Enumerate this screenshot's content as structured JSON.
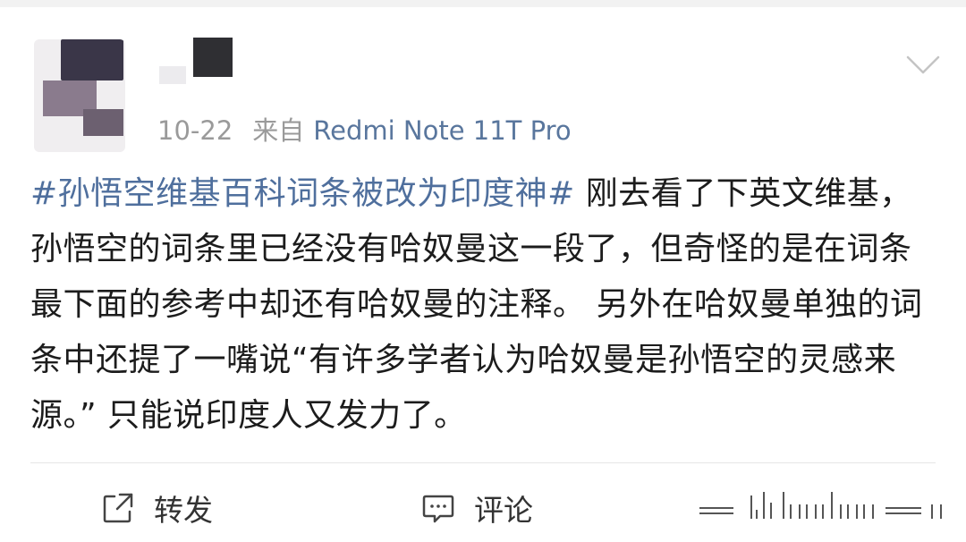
{
  "post": {
    "date": "10-22",
    "source_prefix": "来自",
    "device": "Redmi Note 11T Pro",
    "topic": "#孙悟空维基百科词条被改为印度神#",
    "body": " 刚去看了下英文维基，孙悟空的词条里已经没有哈奴曼这一段了，但奇怪的是在词条最下面的参考中却还有哈奴曼的注释。 另外在哈奴曼单独的词条中还提了一嘴说“有许多学者认为哈奴曼是孙悟空的灵感来源。” 只能说印度人又发力了。"
  },
  "actions": {
    "repost_label": "转发",
    "comment_label": "评论"
  },
  "icons": {
    "repost": "share-icon",
    "comment": "comment-icon",
    "more": "chevron-down-icon"
  },
  "colors": {
    "link": "#4f6f9d",
    "meta": "#9a9a9a",
    "text": "#1c1c1c"
  }
}
